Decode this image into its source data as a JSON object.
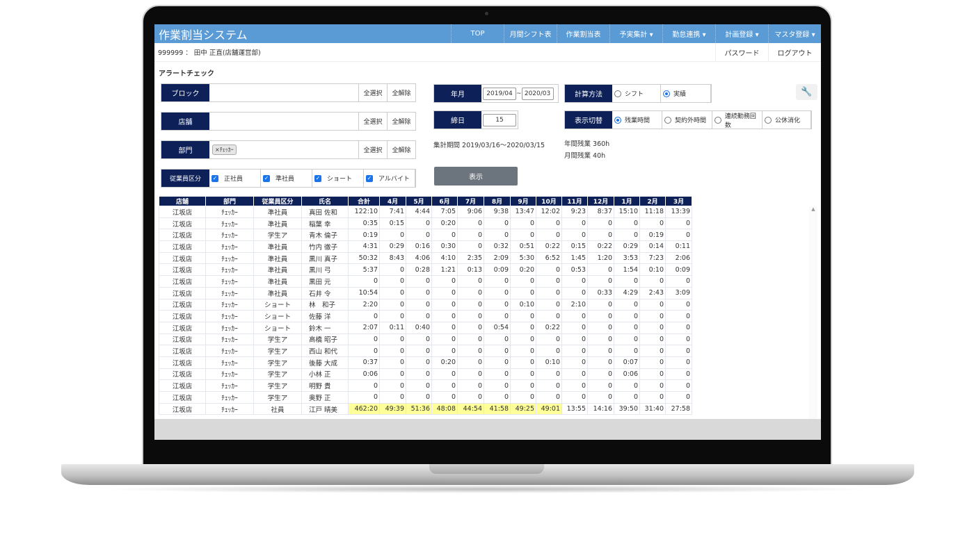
{
  "app_title": "作業割当システム",
  "nav": [
    {
      "label": "TOP"
    },
    {
      "label": "月間シフト表"
    },
    {
      "label": "作業割当表"
    },
    {
      "label": "予実集計 ▾"
    },
    {
      "label": "勤怠連携 ▾"
    },
    {
      "label": "計画登録 ▾"
    },
    {
      "label": "マスタ登録 ▾"
    }
  ],
  "user": "999999 ： 田中 正直(店舗運営部)",
  "password_label": "パスワード",
  "logout_label": "ログアウト",
  "page_title": "アラートチェック",
  "filters": {
    "block": {
      "label": "ブロック",
      "select_all": "全選択",
      "clear_all": "全解除"
    },
    "store": {
      "label": "店舗",
      "select_all": "全選択",
      "clear_all": "全解除"
    },
    "dept": {
      "label": "部門",
      "tag": "×ﾁｪｯｶｰ",
      "select_all": "全選択",
      "clear_all": "全解除"
    },
    "emp_type": {
      "label": "従業員区分",
      "options": [
        {
          "label": "正社員",
          "checked": true
        },
        {
          "label": "準社員",
          "checked": true
        },
        {
          "label": "ショート",
          "checked": true
        },
        {
          "label": "アルバイト",
          "checked": true
        }
      ]
    },
    "year_month": {
      "label": "年月",
      "from": "2019/04",
      "sep": "~",
      "to": "2020/03"
    },
    "cutoff": {
      "label": "締日",
      "value": "15"
    },
    "period": "集計期間 2019/03/16～2020/03/15",
    "show_button": "表示",
    "calc": {
      "label": "計算方法",
      "options": [
        {
          "label": "シフト",
          "selected": false
        },
        {
          "label": "実績",
          "selected": true
        }
      ]
    },
    "display": {
      "label": "表示切替",
      "options": [
        {
          "label": "残業時間",
          "selected": true
        },
        {
          "label": "契約外時間",
          "selected": false
        },
        {
          "label": "連続勤務回数",
          "selected": false
        },
        {
          "label": "公休消化",
          "selected": false
        }
      ]
    },
    "annual_ot": "年間残業 360h",
    "monthly_ot": "月間残業 40h"
  },
  "table": {
    "headers": [
      "店舗",
      "部門",
      "従業員区分",
      "氏名",
      "合計",
      "4月",
      "5月",
      "6月",
      "7月",
      "8月",
      "9月",
      "10月",
      "11月",
      "12月",
      "1月",
      "2月",
      "3月"
    ],
    "rows": [
      [
        "江坂店",
        "ﾁｪｯｶｰ",
        "準社員",
        "真田 佐和",
        "122:10",
        "7:41",
        "4:44",
        "7:05",
        "9:06",
        "9:38",
        "13:47",
        "12:02",
        "9:23",
        "8:37",
        "15:10",
        "11:18",
        "13:39"
      ],
      [
        "江坂店",
        "ﾁｪｯｶｰ",
        "準社員",
        "稲葉 幸",
        "0:35",
        "0:15",
        "0",
        "0:20",
        "0",
        "0",
        "0",
        "0",
        "0",
        "0",
        "0",
        "0",
        "0"
      ],
      [
        "江坂店",
        "ﾁｪｯｶｰ",
        "学生ア",
        "青木 倫子",
        "0:19",
        "0",
        "0",
        "0",
        "0",
        "0",
        "0",
        "0",
        "0",
        "0",
        "0",
        "0:19",
        "0"
      ],
      [
        "江坂店",
        "ﾁｪｯｶｰ",
        "準社員",
        "竹内 徹子",
        "4:31",
        "0:29",
        "0:16",
        "0:30",
        "0",
        "0:32",
        "0:51",
        "0:22",
        "0:15",
        "0:22",
        "0:29",
        "0:14",
        "0:11"
      ],
      [
        "江坂店",
        "ﾁｪｯｶｰ",
        "準社員",
        "黒川 真子",
        "50:32",
        "8:43",
        "4:06",
        "4:10",
        "2:35",
        "2:09",
        "5:30",
        "6:52",
        "1:45",
        "1:20",
        "3:53",
        "7:23",
        "2:06"
      ],
      [
        "江坂店",
        "ﾁｪｯｶｰ",
        "準社員",
        "黒川 弓",
        "5:37",
        "0",
        "0:28",
        "1:21",
        "0:13",
        "0:09",
        "0:20",
        "0",
        "0:53",
        "0",
        "1:54",
        "0:10",
        "0:09"
      ],
      [
        "江坂店",
        "ﾁｪｯｶｰ",
        "準社員",
        "黒田 元",
        "0",
        "0",
        "0",
        "0",
        "0",
        "0",
        "0",
        "0",
        "0",
        "0",
        "0",
        "0",
        "0"
      ],
      [
        "江坂店",
        "ﾁｪｯｶｰ",
        "準社員",
        "石井 令",
        "10:54",
        "0",
        "0",
        "0",
        "0",
        "0",
        "0",
        "0",
        "0",
        "0:33",
        "4:29",
        "2:43",
        "3:09"
      ],
      [
        "江坂店",
        "ﾁｪｯｶｰ",
        "ショート",
        "林　和子",
        "2:20",
        "0",
        "0",
        "0",
        "0",
        "0",
        "0:10",
        "0",
        "2:10",
        "0",
        "0",
        "0",
        "0"
      ],
      [
        "江坂店",
        "ﾁｪｯｶｰ",
        "ショート",
        "佐藤 洋",
        "0",
        "0",
        "0",
        "0",
        "0",
        "0",
        "0",
        "0",
        "0",
        "0",
        "0",
        "0",
        "0"
      ],
      [
        "江坂店",
        "ﾁｪｯｶｰ",
        "ショート",
        "鈴木 一",
        "2:07",
        "0:11",
        "0:40",
        "0",
        "0",
        "0:54",
        "0",
        "0:22",
        "0",
        "0",
        "0",
        "0",
        "0"
      ],
      [
        "江坂店",
        "ﾁｪｯｶｰ",
        "学生ア",
        "高橋 昭子",
        "0",
        "0",
        "0",
        "0",
        "0",
        "0",
        "0",
        "0",
        "0",
        "0",
        "0",
        "0",
        "0"
      ],
      [
        "江坂店",
        "ﾁｪｯｶｰ",
        "学生ア",
        "西山 和代",
        "0",
        "0",
        "0",
        "0",
        "0",
        "0",
        "0",
        "0",
        "0",
        "0",
        "0",
        "0",
        "0"
      ],
      [
        "江坂店",
        "ﾁｪｯｶｰ",
        "学生ア",
        "後藤 大成",
        "0:37",
        "0",
        "0",
        "0:20",
        "0",
        "0",
        "0",
        "0:10",
        "0",
        "0",
        "0:07",
        "0",
        "0"
      ],
      [
        "江坂店",
        "ﾁｪｯｶｰ",
        "学生ア",
        "小林 正",
        "0:06",
        "0",
        "0",
        "0",
        "0",
        "0",
        "0",
        "0",
        "0",
        "0",
        "0:06",
        "0",
        "0"
      ],
      [
        "江坂店",
        "ﾁｪｯｶｰ",
        "学生ア",
        "明野 貴",
        "0",
        "0",
        "0",
        "0",
        "0",
        "0",
        "0",
        "0",
        "0",
        "0",
        "0",
        "0",
        "0"
      ],
      [
        "江坂店",
        "ﾁｪｯｶｰ",
        "学生ア",
        "奥野 正",
        "0",
        "0",
        "0",
        "0",
        "0",
        "0",
        "0",
        "0",
        "0",
        "0",
        "0",
        "0",
        "0"
      ],
      [
        "江坂店",
        "ﾁｪｯｶｰ",
        "社員",
        "江戸 晴美",
        "462:20",
        "49:39",
        "51:36",
        "48:08",
        "44:54",
        "41:58",
        "49:25",
        "49:01",
        "13:55",
        "14:16",
        "39:50",
        "31:40",
        "27:58"
      ]
    ],
    "highlight": {
      "row": 17,
      "cols": [
        4,
        5,
        6,
        7,
        8,
        9,
        10,
        11
      ],
      "color": "#ffff99"
    }
  },
  "colors": {
    "topbar": "#5b9bd5",
    "label_bg": "#0d2158",
    "button": "#6c757d"
  }
}
